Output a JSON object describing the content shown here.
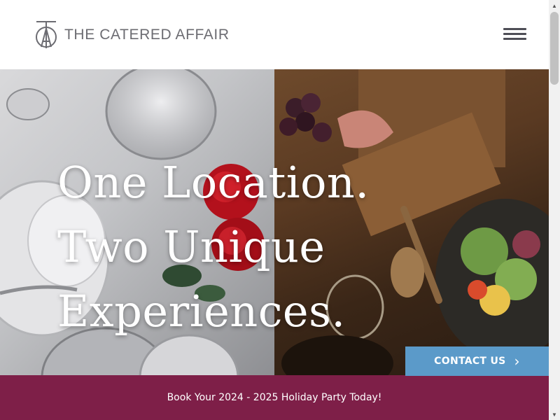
{
  "header": {
    "logo_monogram": "TCA",
    "logo_text": "THE CATERED AFFAIR"
  },
  "hero": {
    "headline_lines": [
      "One Location.",
      "Two Unique",
      "Experiences."
    ]
  },
  "cta": {
    "contact_label": "CONTACT US",
    "chevron_glyph": "›"
  },
  "banner": {
    "text": "Book Your 2024 - 2025 Holiday Party Today!"
  },
  "scrollbar": {
    "up_glyph": "▲",
    "down_glyph": "▼"
  },
  "colors": {
    "banner_bg": "#7e1f48",
    "contact_bg": "#5b9ac9",
    "logo_text": "#6c6c72"
  },
  "icons": [
    "logo-monogram-icon",
    "hamburger-menu-icon",
    "chevron-right-icon"
  ]
}
